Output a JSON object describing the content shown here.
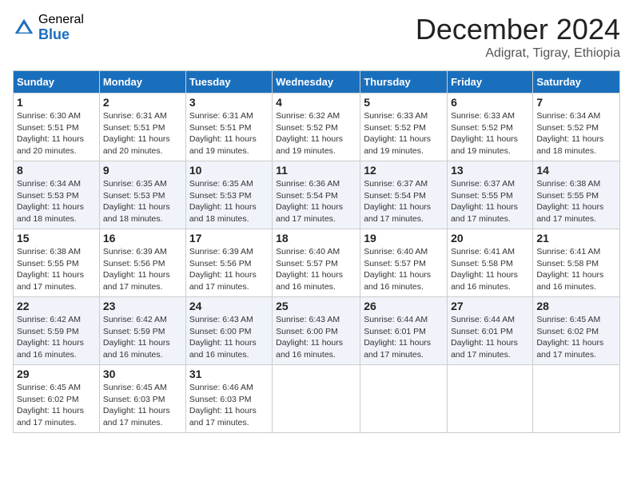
{
  "logo": {
    "general": "General",
    "blue": "Blue"
  },
  "title": "December 2024",
  "location": "Adigrat, Tigray, Ethiopia",
  "days_of_week": [
    "Sunday",
    "Monday",
    "Tuesday",
    "Wednesday",
    "Thursday",
    "Friday",
    "Saturday"
  ],
  "weeks": [
    [
      {
        "day": "1",
        "info": "Sunrise: 6:30 AM\nSunset: 5:51 PM\nDaylight: 11 hours and 20 minutes."
      },
      {
        "day": "2",
        "info": "Sunrise: 6:31 AM\nSunset: 5:51 PM\nDaylight: 11 hours and 20 minutes."
      },
      {
        "day": "3",
        "info": "Sunrise: 6:31 AM\nSunset: 5:51 PM\nDaylight: 11 hours and 19 minutes."
      },
      {
        "day": "4",
        "info": "Sunrise: 6:32 AM\nSunset: 5:52 PM\nDaylight: 11 hours and 19 minutes."
      },
      {
        "day": "5",
        "info": "Sunrise: 6:33 AM\nSunset: 5:52 PM\nDaylight: 11 hours and 19 minutes."
      },
      {
        "day": "6",
        "info": "Sunrise: 6:33 AM\nSunset: 5:52 PM\nDaylight: 11 hours and 19 minutes."
      },
      {
        "day": "7",
        "info": "Sunrise: 6:34 AM\nSunset: 5:52 PM\nDaylight: 11 hours and 18 minutes."
      }
    ],
    [
      {
        "day": "8",
        "info": "Sunrise: 6:34 AM\nSunset: 5:53 PM\nDaylight: 11 hours and 18 minutes."
      },
      {
        "day": "9",
        "info": "Sunrise: 6:35 AM\nSunset: 5:53 PM\nDaylight: 11 hours and 18 minutes."
      },
      {
        "day": "10",
        "info": "Sunrise: 6:35 AM\nSunset: 5:53 PM\nDaylight: 11 hours and 18 minutes."
      },
      {
        "day": "11",
        "info": "Sunrise: 6:36 AM\nSunset: 5:54 PM\nDaylight: 11 hours and 17 minutes."
      },
      {
        "day": "12",
        "info": "Sunrise: 6:37 AM\nSunset: 5:54 PM\nDaylight: 11 hours and 17 minutes."
      },
      {
        "day": "13",
        "info": "Sunrise: 6:37 AM\nSunset: 5:55 PM\nDaylight: 11 hours and 17 minutes."
      },
      {
        "day": "14",
        "info": "Sunrise: 6:38 AM\nSunset: 5:55 PM\nDaylight: 11 hours and 17 minutes."
      }
    ],
    [
      {
        "day": "15",
        "info": "Sunrise: 6:38 AM\nSunset: 5:55 PM\nDaylight: 11 hours and 17 minutes."
      },
      {
        "day": "16",
        "info": "Sunrise: 6:39 AM\nSunset: 5:56 PM\nDaylight: 11 hours and 17 minutes."
      },
      {
        "day": "17",
        "info": "Sunrise: 6:39 AM\nSunset: 5:56 PM\nDaylight: 11 hours and 17 minutes."
      },
      {
        "day": "18",
        "info": "Sunrise: 6:40 AM\nSunset: 5:57 PM\nDaylight: 11 hours and 16 minutes."
      },
      {
        "day": "19",
        "info": "Sunrise: 6:40 AM\nSunset: 5:57 PM\nDaylight: 11 hours and 16 minutes."
      },
      {
        "day": "20",
        "info": "Sunrise: 6:41 AM\nSunset: 5:58 PM\nDaylight: 11 hours and 16 minutes."
      },
      {
        "day": "21",
        "info": "Sunrise: 6:41 AM\nSunset: 5:58 PM\nDaylight: 11 hours and 16 minutes."
      }
    ],
    [
      {
        "day": "22",
        "info": "Sunrise: 6:42 AM\nSunset: 5:59 PM\nDaylight: 11 hours and 16 minutes."
      },
      {
        "day": "23",
        "info": "Sunrise: 6:42 AM\nSunset: 5:59 PM\nDaylight: 11 hours and 16 minutes."
      },
      {
        "day": "24",
        "info": "Sunrise: 6:43 AM\nSunset: 6:00 PM\nDaylight: 11 hours and 16 minutes."
      },
      {
        "day": "25",
        "info": "Sunrise: 6:43 AM\nSunset: 6:00 PM\nDaylight: 11 hours and 16 minutes."
      },
      {
        "day": "26",
        "info": "Sunrise: 6:44 AM\nSunset: 6:01 PM\nDaylight: 11 hours and 17 minutes."
      },
      {
        "day": "27",
        "info": "Sunrise: 6:44 AM\nSunset: 6:01 PM\nDaylight: 11 hours and 17 minutes."
      },
      {
        "day": "28",
        "info": "Sunrise: 6:45 AM\nSunset: 6:02 PM\nDaylight: 11 hours and 17 minutes."
      }
    ],
    [
      {
        "day": "29",
        "info": "Sunrise: 6:45 AM\nSunset: 6:02 PM\nDaylight: 11 hours and 17 minutes."
      },
      {
        "day": "30",
        "info": "Sunrise: 6:45 AM\nSunset: 6:03 PM\nDaylight: 11 hours and 17 minutes."
      },
      {
        "day": "31",
        "info": "Sunrise: 6:46 AM\nSunset: 6:03 PM\nDaylight: 11 hours and 17 minutes."
      },
      null,
      null,
      null,
      null
    ]
  ]
}
